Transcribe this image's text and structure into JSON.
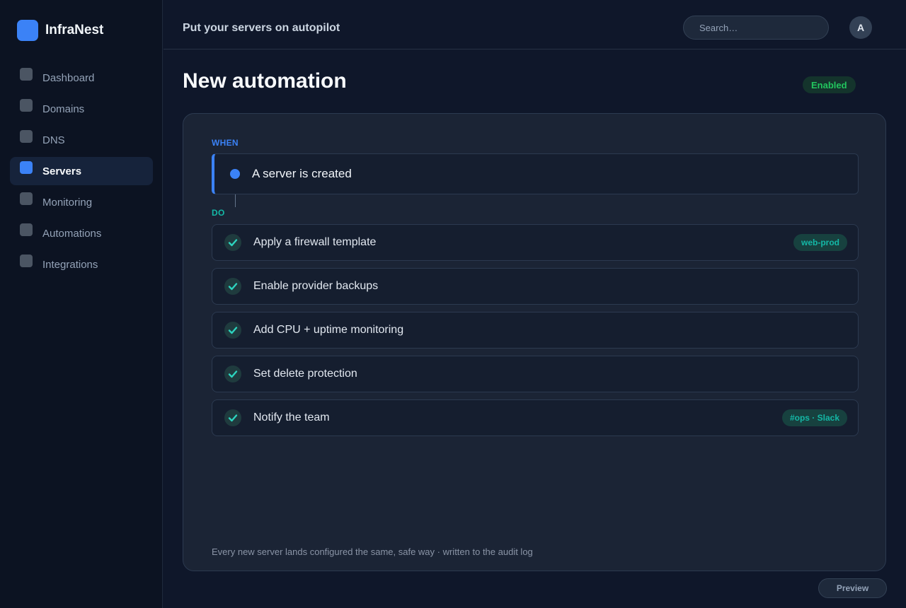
{
  "brand": {
    "name": "InfraNest",
    "logo_color": "#3b82f6"
  },
  "sidebar": {
    "items": [
      {
        "label": "Dashboard",
        "active": false
      },
      {
        "label": "Domains",
        "active": false
      },
      {
        "label": "DNS",
        "active": false
      },
      {
        "label": "Servers",
        "active": true
      },
      {
        "label": "Monitoring",
        "active": false
      },
      {
        "label": "Automations",
        "active": false
      },
      {
        "label": "Integrations",
        "active": false
      }
    ]
  },
  "header": {
    "tagline": "Put your servers on autopilot",
    "search_placeholder": "Search…",
    "avatar_initial": "A"
  },
  "page": {
    "title": "New automation",
    "status_badge": "Enabled"
  },
  "automation": {
    "when_label": "WHEN",
    "trigger": "A server is created",
    "do_label": "DO",
    "actions": [
      {
        "label": "Apply a firewall template",
        "tag": "web-prod",
        "icon": "check-icon"
      },
      {
        "label": "Enable provider backups",
        "tag": "",
        "icon": "check-icon"
      },
      {
        "label": "Add CPU + uptime monitoring",
        "tag": "",
        "icon": "check-icon"
      },
      {
        "label": "Set delete protection",
        "tag": "",
        "icon": "check-icon"
      },
      {
        "label": "Notify the team",
        "tag": "#ops · Slack",
        "icon": "check-icon"
      }
    ],
    "footnote": "Every new server lands configured the same, safe way · written to the audit log"
  },
  "footer": {
    "preview_label": "Preview"
  },
  "colors": {
    "accent": "#3b82f6",
    "success": "#22c55e",
    "teal": "#14b8a6",
    "background": "#0f172a"
  }
}
